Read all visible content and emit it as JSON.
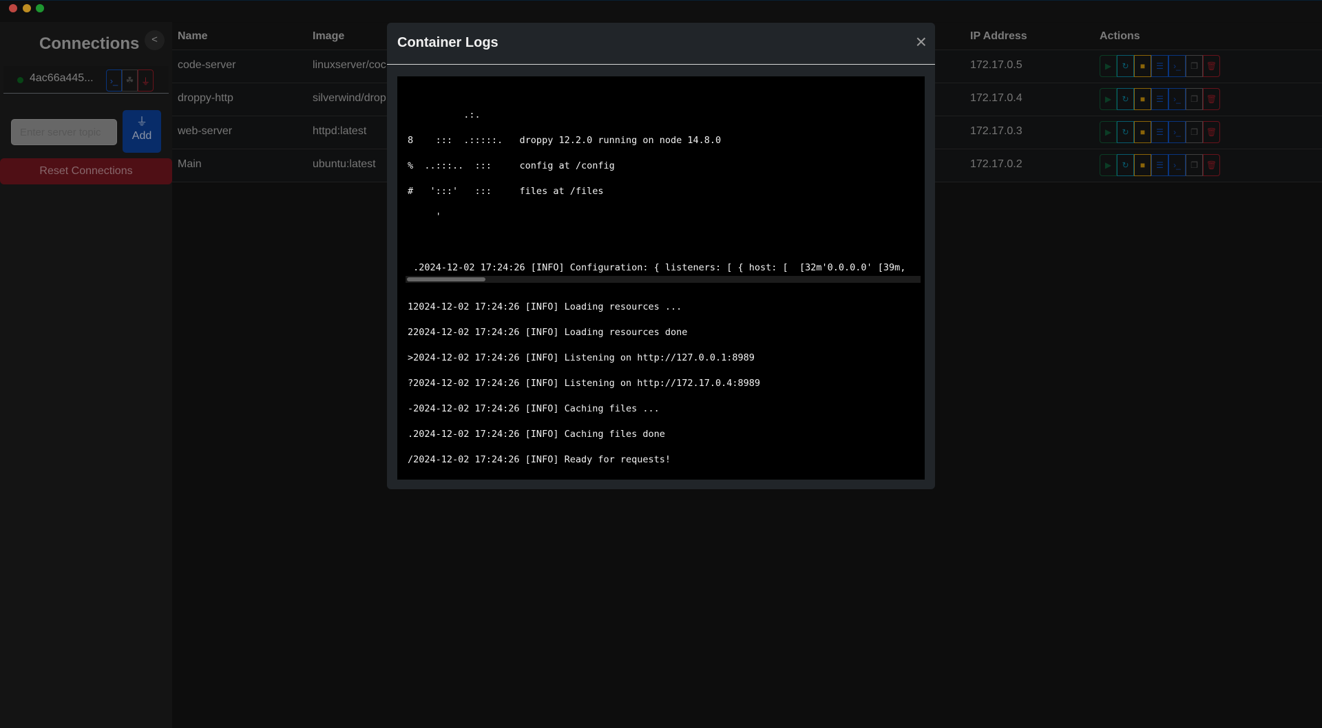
{
  "window": {
    "controls": [
      "close",
      "minimize",
      "maximize"
    ]
  },
  "sidebar": {
    "title": "Connections",
    "collapse_label": "<",
    "connection": {
      "id": "4ac66a445...",
      "status": "connected",
      "status_color": "#0b5d1e",
      "buttons": [
        "terminal-icon",
        "network-icon",
        "plug-disconnect-icon"
      ]
    },
    "topic_placeholder": "Enter server topic",
    "add_label": "Add",
    "reset_label": "Reset Connections"
  },
  "table": {
    "headers": {
      "name": "Name",
      "image": "Image",
      "ip": "IP Address",
      "actions": "Actions"
    },
    "rows": [
      {
        "name": "code-server",
        "image": "linuxserver/coc",
        "ip": "172.17.0.5"
      },
      {
        "name": "droppy-http",
        "image": "silverwind/drop",
        "ip": "172.17.0.4"
      },
      {
        "name": "web-server",
        "image": "httpd:latest",
        "ip": "172.17.0.3"
      },
      {
        "name": "Main",
        "image": "ubuntu:latest",
        "ip": "172.17.0.2"
      }
    ],
    "action_buttons": [
      {
        "icon": "play-icon",
        "glyph": "▶",
        "color": "#0f5132"
      },
      {
        "icon": "restart-icon",
        "glyph": "↻",
        "color": "#0a7a93"
      },
      {
        "icon": "stop-icon",
        "glyph": "■",
        "color": "#b8860b"
      },
      {
        "icon": "logs-icon",
        "glyph": "☰",
        "color": "#0d47a8"
      },
      {
        "icon": "terminal-icon",
        "glyph": "›_",
        "color": "#0d47a8"
      },
      {
        "icon": "clone-icon",
        "glyph": "❐",
        "color": "#555"
      },
      {
        "icon": "delete-icon",
        "glyph": "🗑",
        "color": "#8b1a24"
      }
    ]
  },
  "modal": {
    "title": "Container Logs",
    "close_label": "×",
    "lines": [
      "          .:.",
      "8    :::  .:::::.   droppy 12.2.0 running on node 14.8.0",
      "%  ..:::..  :::     config at /config",
      "#   ':::'   :::     files at /files",
      "     '",
      " .2024-12-02 17:24:26 [INFO] Configuration: { listeners: [ { host: [  [32m'0.0.0.0' [39m,",
      "12024-12-02 17:24:26 [INFO] Loading resources ...",
      "22024-12-02 17:24:26 [INFO] Loading resources done",
      ">2024-12-02 17:24:26 [INFO] Listening on http://127.0.0.1:8989",
      "?2024-12-02 17:24:26 [INFO] Listening on http://172.17.0.4:8989",
      "-2024-12-02 17:24:26 [INFO] Caching files ...",
      ".2024-12-02 17:24:26 [INFO] Caching files done",
      "/2024-12-02 17:24:26 [INFO] Ready for requests!"
    ]
  }
}
